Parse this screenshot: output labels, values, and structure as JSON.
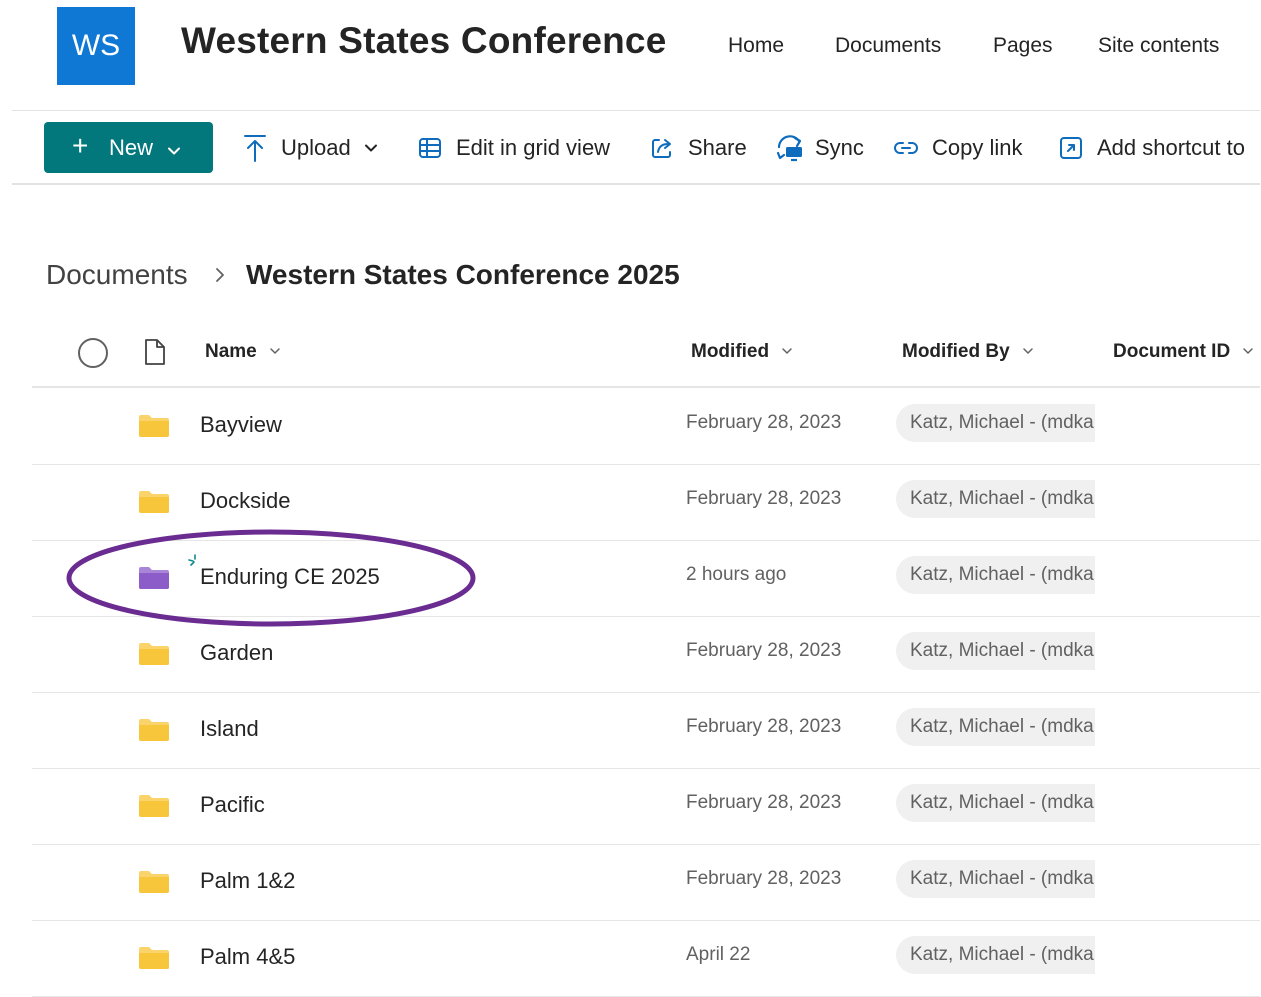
{
  "site": {
    "logo_text": "WS",
    "title": "Western States Conference",
    "nav": [
      "Home",
      "Documents",
      "Pages",
      "Site contents"
    ],
    "accent": "#0f78d4"
  },
  "commands": {
    "new": "New",
    "upload": "Upload",
    "edit_grid": "Edit in grid view",
    "share": "Share",
    "sync": "Sync",
    "copy_link": "Copy link",
    "add_shortcut": "Add shortcut to",
    "new_button_color": "#03787c"
  },
  "breadcrumb": {
    "root": "Documents",
    "current": "Western States Conference 2025"
  },
  "columns": {
    "name": "Name",
    "modified": "Modified",
    "modified_by": "Modified By",
    "document_id": "Document ID"
  },
  "rows": [
    {
      "name": "Bayview",
      "modified": "February 28, 2023",
      "modified_by": "Katz, Michael - (mdka",
      "folder_color": "#f8c63a"
    },
    {
      "name": "Dockside",
      "modified": "February 28, 2023",
      "modified_by": "Katz, Michael - (mdka",
      "folder_color": "#f8c63a"
    },
    {
      "name": "Enduring CE 2025",
      "modified": "2 hours ago",
      "modified_by": "Katz, Michael - (mdka",
      "folder_color": "#8c5cc9",
      "is_new": true,
      "highlighted": true
    },
    {
      "name": "Garden",
      "modified": "February 28, 2023",
      "modified_by": "Katz, Michael - (mdka",
      "folder_color": "#f8c63a"
    },
    {
      "name": "Island",
      "modified": "February 28, 2023",
      "modified_by": "Katz, Michael - (mdka",
      "folder_color": "#f8c63a"
    },
    {
      "name": "Pacific",
      "modified": "February 28, 2023",
      "modified_by": "Katz, Michael - (mdka",
      "folder_color": "#f8c63a"
    },
    {
      "name": "Palm 1&2",
      "modified": "February 28, 2023",
      "modified_by": "Katz, Michael - (mdka",
      "folder_color": "#f8c63a"
    },
    {
      "name": "Palm 4&5",
      "modified": "April 22",
      "modified_by": "Katz, Michael - (mdka",
      "folder_color": "#f8c63a"
    }
  ],
  "highlight_color": "#6b2c91"
}
